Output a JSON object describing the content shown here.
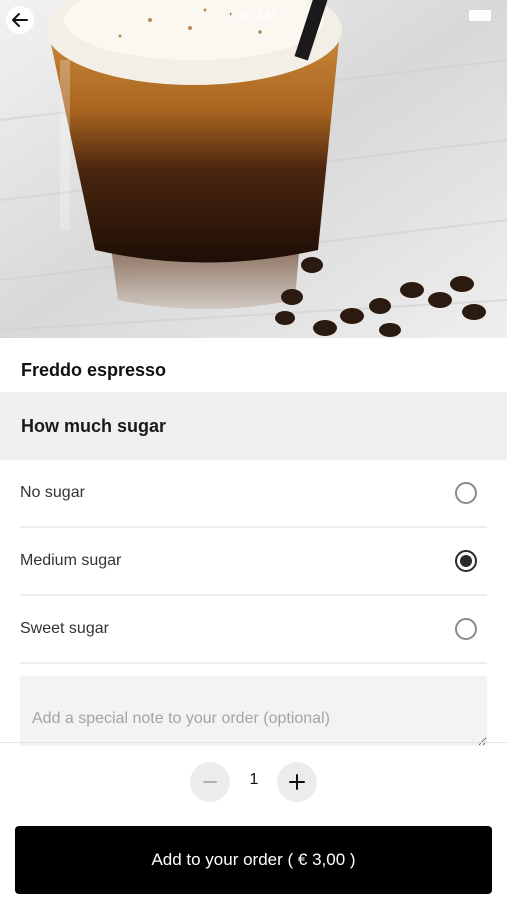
{
  "status_bar": {
    "time": "9:45 AM"
  },
  "product": {
    "title": "Freddo espresso"
  },
  "section": {
    "title": "How much sugar"
  },
  "options": [
    {
      "label": "No sugar",
      "selected": false
    },
    {
      "label": "Medium sugar",
      "selected": true
    },
    {
      "label": "Sweet sugar",
      "selected": false
    }
  ],
  "note": {
    "placeholder": "Add a special note to your order (optional)"
  },
  "quantity": {
    "value": "1"
  },
  "footer": {
    "add_label": "Add to your order ( € 3,00 )"
  },
  "colors": {
    "button_bg": "#000000",
    "section_bg": "#f1f0ee",
    "radio_checked": "#2a2a2a"
  },
  "icons": {
    "back": "arrow-left-icon",
    "minus": "minus-icon",
    "plus": "plus-icon"
  }
}
